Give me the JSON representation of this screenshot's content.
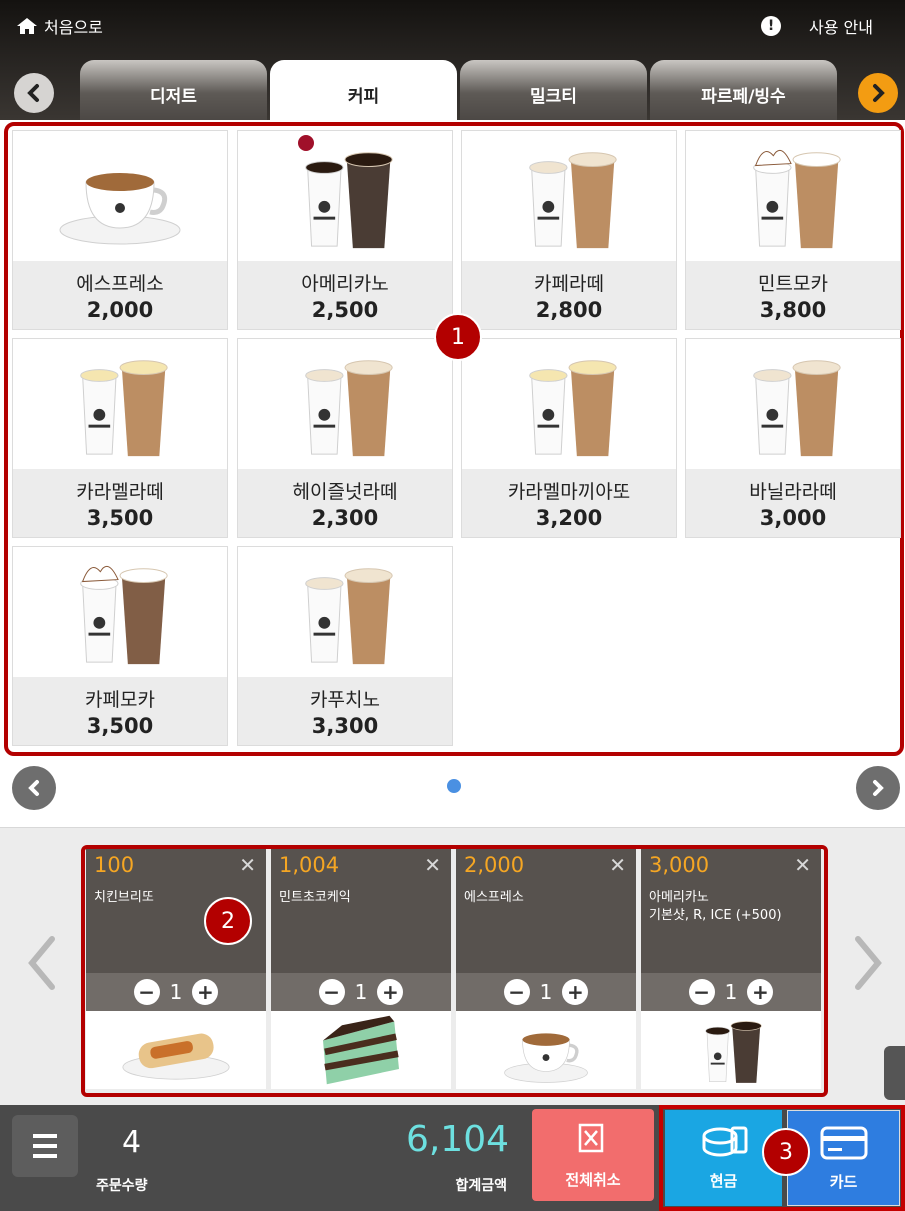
{
  "header": {
    "home_label": "처음으로",
    "help_label": "사용 안내",
    "tabs": [
      {
        "label": "디저트"
      },
      {
        "label": "커피"
      },
      {
        "label": "밀크티"
      },
      {
        "label": "파르페/빙수"
      }
    ],
    "active_tab": "커피"
  },
  "menu": {
    "items": [
      {
        "name": "에스프레소",
        "price": "2,000",
        "icon": "espresso-cup-icon"
      },
      {
        "name": "아메리카노",
        "price": "2,500",
        "icon": "americano-cups-icon",
        "has_new_badge": true
      },
      {
        "name": "카페라떼",
        "price": "2,800",
        "icon": "latte-cups-icon"
      },
      {
        "name": "민트모카",
        "price": "3,800",
        "icon": "cream-drink-icon"
      },
      {
        "name": "카라멜라떼",
        "price": "3,500",
        "icon": "caramel-drink-icon"
      },
      {
        "name": "헤이즐넛라떼",
        "price": "2,300",
        "icon": "latte-cups-icon"
      },
      {
        "name": "카라멜마끼아또",
        "price": "3,200",
        "icon": "caramel-drink-icon"
      },
      {
        "name": "바닐라라떼",
        "price": "3,000",
        "icon": "latte-cups-icon"
      },
      {
        "name": "카페모카",
        "price": "3,500",
        "icon": "mocha-drink-icon"
      },
      {
        "name": "카푸치노",
        "price": "3,300",
        "icon": "latte-cups-icon"
      }
    ]
  },
  "callouts": [
    "1",
    "2",
    "3"
  ],
  "cart": {
    "items": [
      {
        "price": "100",
        "name": "치킨브리또",
        "qty": "1",
        "icon": "burrito-icon"
      },
      {
        "price": "1,004",
        "name": "민트초코케익",
        "qty": "1",
        "icon": "cake-icon"
      },
      {
        "price": "2,000",
        "name": "에스프레소",
        "qty": "1",
        "icon": "espresso-cup-icon"
      },
      {
        "price": "3,000",
        "name": "아메리카노\n기본샷, R, ICE (+500)",
        "qty": "1",
        "icon": "americano-cups-icon"
      }
    ]
  },
  "footer": {
    "order_count": "4",
    "order_count_label": "주문수량",
    "total": "6,104",
    "total_label": "합계금액",
    "cancel_all_label": "전체취소",
    "cash_label": "현금",
    "card_label": "카드"
  },
  "colors": {
    "callout_red": "#b30000",
    "price_orange": "#f5a623",
    "total_cyan": "#6de0e0",
    "cancel_red": "#f26d6d",
    "cash_blue": "#1aa6e3",
    "card_blue": "#2e7de0"
  }
}
